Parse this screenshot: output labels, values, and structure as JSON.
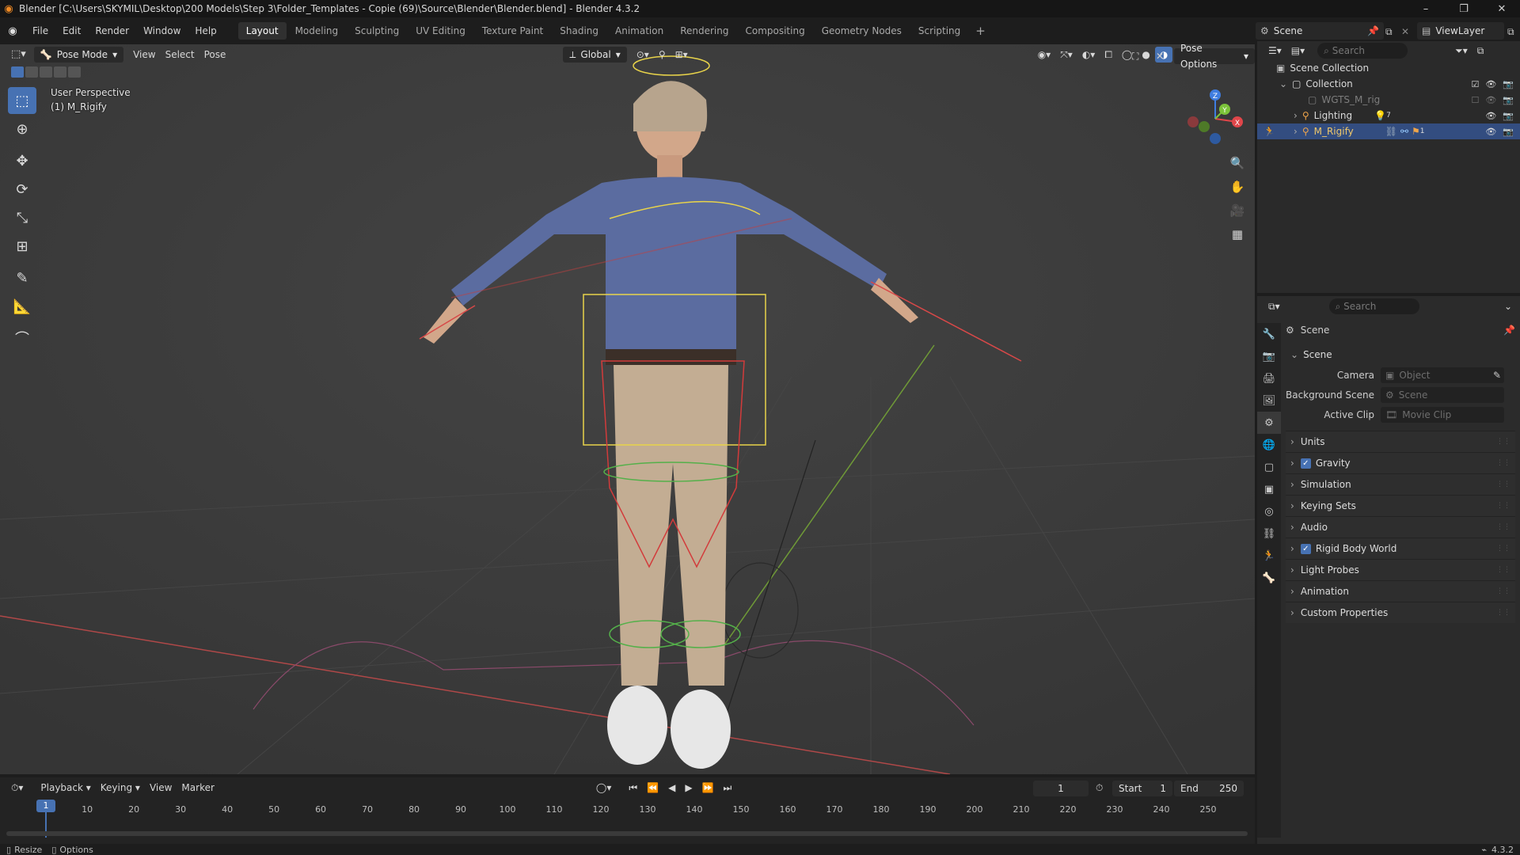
{
  "titlebar": {
    "title": "Blender [C:\\Users\\SKYMIL\\Desktop\\200 Models\\Step 3\\Folder_Templates - Copie (69)\\Source\\Blender\\Blender.blend] - Blender 4.3.2",
    "minimize": "–",
    "maximize": "❐",
    "close": "✕"
  },
  "menu": [
    "File",
    "Edit",
    "Render",
    "Window",
    "Help"
  ],
  "workspaces": [
    "Layout",
    "Modeling",
    "Sculpting",
    "UV Editing",
    "Texture Paint",
    "Shading",
    "Animation",
    "Rendering",
    "Compositing",
    "Geometry Nodes",
    "Scripting"
  ],
  "active_workspace": "Layout",
  "scene_selector": "Scene",
  "viewlayer_selector": "ViewLayer",
  "viewport": {
    "mode": "Pose Mode",
    "menus": [
      "View",
      "Select",
      "Pose"
    ],
    "orientation": "Global",
    "pose_options": "Pose Options",
    "view_name": "User Perspective",
    "object_name": "(1) M_Rigify",
    "gizmo": {
      "x": "X",
      "y": "Y",
      "z": "Z"
    }
  },
  "timeline": {
    "menus": [
      "Playback",
      "Keying",
      "View",
      "Marker"
    ],
    "current_frame": "1",
    "start_label": "Start",
    "start": "1",
    "end_label": "End",
    "end": "250",
    "ticks": [
      "1",
      "10",
      "20",
      "30",
      "40",
      "50",
      "60",
      "70",
      "80",
      "90",
      "100",
      "110",
      "120",
      "130",
      "140",
      "150",
      "160",
      "170",
      "180",
      "190",
      "200",
      "210",
      "220",
      "230",
      "240",
      "250"
    ]
  },
  "outliner": {
    "search_placeholder": "Search",
    "rows": [
      {
        "label": "Scene Collection"
      },
      {
        "label": "Collection"
      },
      {
        "label": "WGTS_M_rig"
      },
      {
        "label": "Lighting"
      },
      {
        "label": "M_Rigify"
      }
    ],
    "lighting_count": "7",
    "rig_count": "1"
  },
  "properties": {
    "search_placeholder": "Search",
    "context": "Scene",
    "section": "Scene",
    "fields": [
      {
        "label": "Camera",
        "placeholder": "Object"
      },
      {
        "label": "Background Scene",
        "placeholder": "Scene"
      },
      {
        "label": "Active Clip",
        "placeholder": "Movie Clip"
      }
    ],
    "panels": [
      {
        "label": "Units",
        "checkbox": false
      },
      {
        "label": "Gravity",
        "checkbox": true
      },
      {
        "label": "Simulation",
        "checkbox": false
      },
      {
        "label": "Keying Sets",
        "checkbox": false
      },
      {
        "label": "Audio",
        "checkbox": false
      },
      {
        "label": "Rigid Body World",
        "checkbox": true
      },
      {
        "label": "Light Probes",
        "checkbox": false
      },
      {
        "label": "Animation",
        "checkbox": false
      },
      {
        "label": "Custom Properties",
        "checkbox": false
      }
    ]
  },
  "statusbar": {
    "resize": "Resize",
    "options": "Options",
    "version": "4.3.2"
  },
  "colors": {
    "accent": "#4772b3",
    "selection": "#334d80",
    "viewport_bg": "#393939",
    "x_axis": "#e0464a",
    "y_axis": "#7cc33a",
    "z_axis": "#3f7de0"
  }
}
